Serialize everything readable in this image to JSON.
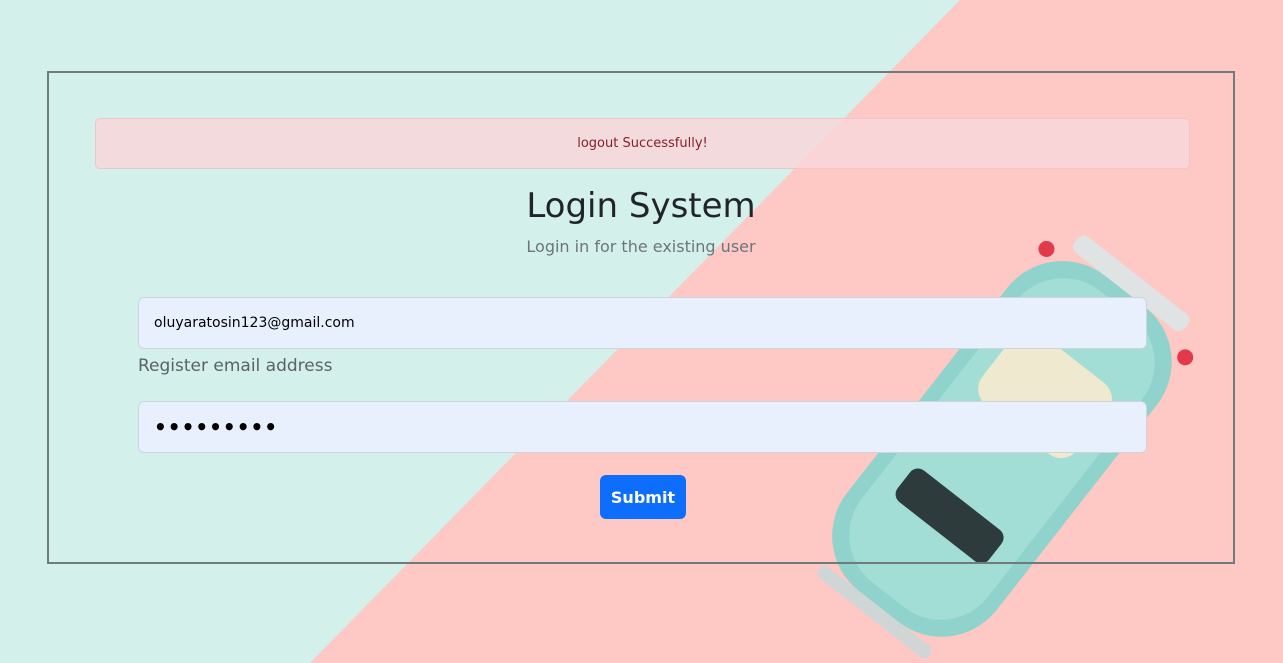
{
  "alert": {
    "message": "logout Successfully!"
  },
  "heading": {
    "title": "Login System",
    "subtitle": "Login in for the existing user"
  },
  "form": {
    "email_value": "oluyaratosin123@gmail.com",
    "email_help": "Register email address",
    "password_value": "•••••••••",
    "submit_label": "Submit"
  },
  "colors": {
    "background_mint": "#d3f0ea",
    "background_pink": "#fec8c4",
    "alert_bg": "#f8d7da",
    "alert_text": "#842029",
    "primary": "#0d6efd",
    "input_bg": "#e8f0fe"
  }
}
